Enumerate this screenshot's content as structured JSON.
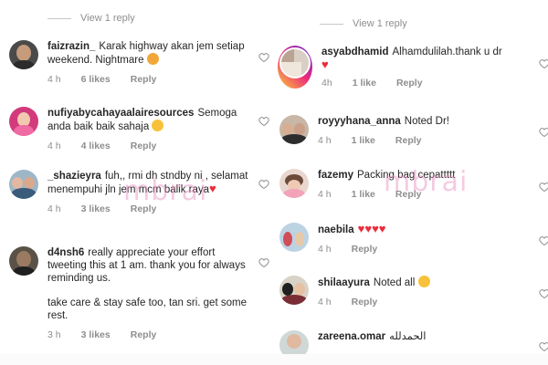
{
  "left": {
    "view_replies": "View 1 reply",
    "comments": [
      {
        "user": "faizrazin_",
        "text": "Karak highway akan jem setiap weekend. Nightmare",
        "emoji": "frustrated-face",
        "time": "4 h",
        "likes": "6 likes",
        "reply": "Reply"
      },
      {
        "user": "nufiyabycahayaalairesources",
        "text": "Semoga anda baik baik sahaja",
        "emoji": "smiling-face",
        "time": "4 h",
        "likes": "4 likes",
        "reply": "Reply"
      },
      {
        "user": "_shazieyra",
        "text": "fuh,, rmi dh stndby ni , selamat menempuhi jln jem mcm balik raya",
        "emoji": "red-heart",
        "time": "4 h",
        "likes": "3 likes",
        "reply": "Reply"
      },
      {
        "user": "d4nsh6",
        "text": "really appreciate your effort tweeting this at 1 am. thank you for always reminding us.",
        "text2": "take care & stay safe too, tan sri. get some rest.",
        "time": "3 h",
        "likes": "3 likes",
        "reply": "Reply"
      }
    ]
  },
  "right": {
    "view_replies": "View 1 reply",
    "comments": [
      {
        "user": "asyabdhamid",
        "text": "Alhamdulilah.thank u dr",
        "emoji": "red-heart",
        "time": "4h",
        "likes": "1 like",
        "reply": "Reply"
      },
      {
        "user": "royyyhana_anna",
        "text": "Noted Dr!",
        "time": "4 h",
        "likes": "1 like",
        "reply": "Reply"
      },
      {
        "user": "fazemy",
        "text": "Packing bag cepattttt",
        "time": "4 h",
        "likes": "1 like",
        "reply": "Reply"
      },
      {
        "user": "naebila",
        "text": "",
        "emoji": "red-heart-x4",
        "time": "4 h",
        "reply": "Reply"
      },
      {
        "user": "shilaayura",
        "text": "Noted all",
        "emoji": "heart-eyes",
        "time": "4 h",
        "reply": "Reply"
      },
      {
        "user": "zareena.omar",
        "text": "الحمدلله",
        "time": "",
        "reply": ""
      }
    ]
  },
  "watermark": "mbrai",
  "colors": {
    "text": "#262626",
    "meta": "#8e8e8e",
    "heart": "#ed2c3b",
    "ring_start": "#f9ce34",
    "ring_mid": "#ee2a7b",
    "ring_end": "#6228d7"
  }
}
